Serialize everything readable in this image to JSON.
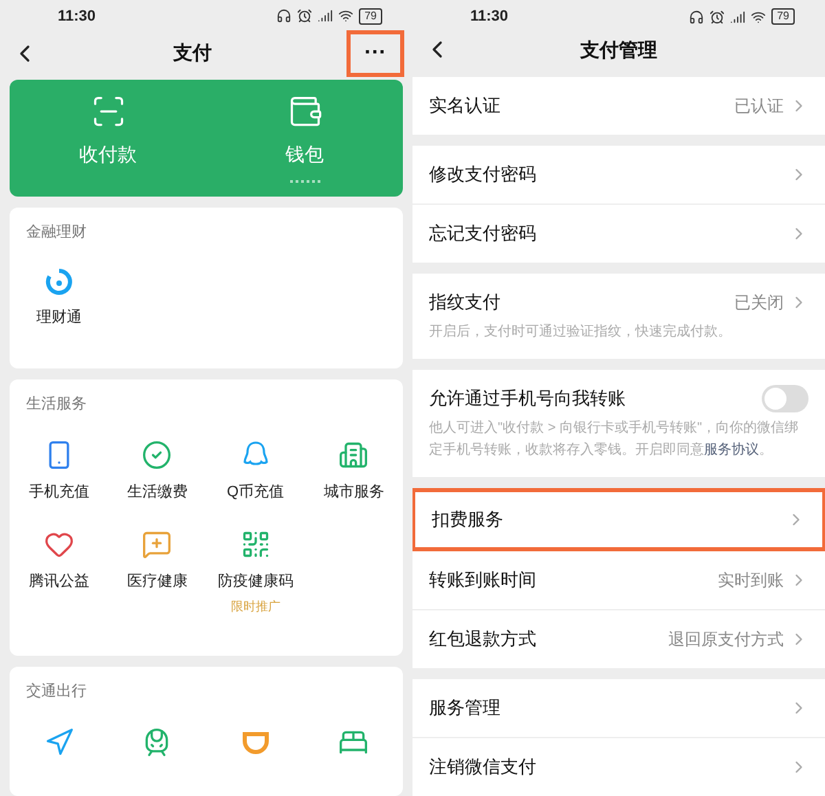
{
  "left": {
    "status_bar": {
      "time": "11:30",
      "battery": "79"
    },
    "nav": {
      "title": "支付",
      "more": {
        "label": "···",
        "highlighted": true
      }
    },
    "top_card": [
      {
        "label": "收付款",
        "kind": "scan"
      },
      {
        "label": "钱包",
        "kind": "wallet"
      }
    ],
    "sections": [
      {
        "title": "金融理财",
        "items": [
          {
            "label": "理财通",
            "kind": "licai"
          }
        ]
      },
      {
        "title": "生活服务",
        "items": [
          {
            "label": "手机充值",
            "kind": "phone"
          },
          {
            "label": "生活缴费",
            "kind": "bill"
          },
          {
            "label": "Q币充值",
            "kind": "qcoin"
          },
          {
            "label": "城市服务",
            "kind": "city"
          },
          {
            "label": "腾讯公益",
            "kind": "charity"
          },
          {
            "label": "医疗健康",
            "kind": "medical"
          },
          {
            "label": "防疫健康码",
            "kind": "qr",
            "badge": "限时推广"
          }
        ]
      },
      {
        "title": "交通出行",
        "items": [
          {
            "kind": "travel"
          },
          {
            "kind": "train"
          },
          {
            "kind": "didi"
          },
          {
            "kind": "hotel"
          }
        ]
      }
    ]
  },
  "right": {
    "status_bar": {
      "time": "11:30",
      "battery": "79"
    },
    "nav": {
      "title": "支付管理"
    },
    "groups": [
      [
        {
          "label": "实名认证",
          "kind": "link",
          "value": "已认证",
          "highlighted": false
        }
      ],
      [
        {
          "label": "修改支付密码",
          "kind": "link",
          "highlighted": false
        },
        {
          "label": "忘记支付密码",
          "kind": "link",
          "highlighted": false
        }
      ],
      [
        {
          "label": "指纹支付",
          "kind": "link",
          "value": "已关闭",
          "description": "开启后，支付时可通过验证指纹，快速完成付款。",
          "highlighted": false
        }
      ],
      [
        {
          "label": "允许通过手机号向我转账",
          "kind": "toggle",
          "on": false,
          "description": "他人可进入\"收付款 > 向银行卡或手机号转账\"，向你的微信绑定手机号转账，收款将存入零钱。开启即同意**服务协议**。",
          "highlighted": false
        }
      ],
      [
        {
          "label": "扣费服务",
          "kind": "link",
          "highlighted": true
        },
        {
          "label": "转账到账时间",
          "kind": "link",
          "value": "实时到账",
          "highlighted": false
        },
        {
          "label": "红包退款方式",
          "kind": "link",
          "value": "退回原支付方式",
          "highlighted": false
        }
      ],
      [
        {
          "label": "服务管理",
          "kind": "link",
          "highlighted": false
        },
        {
          "label": "注销微信支付",
          "kind": "link",
          "highlighted": false
        }
      ]
    ]
  }
}
